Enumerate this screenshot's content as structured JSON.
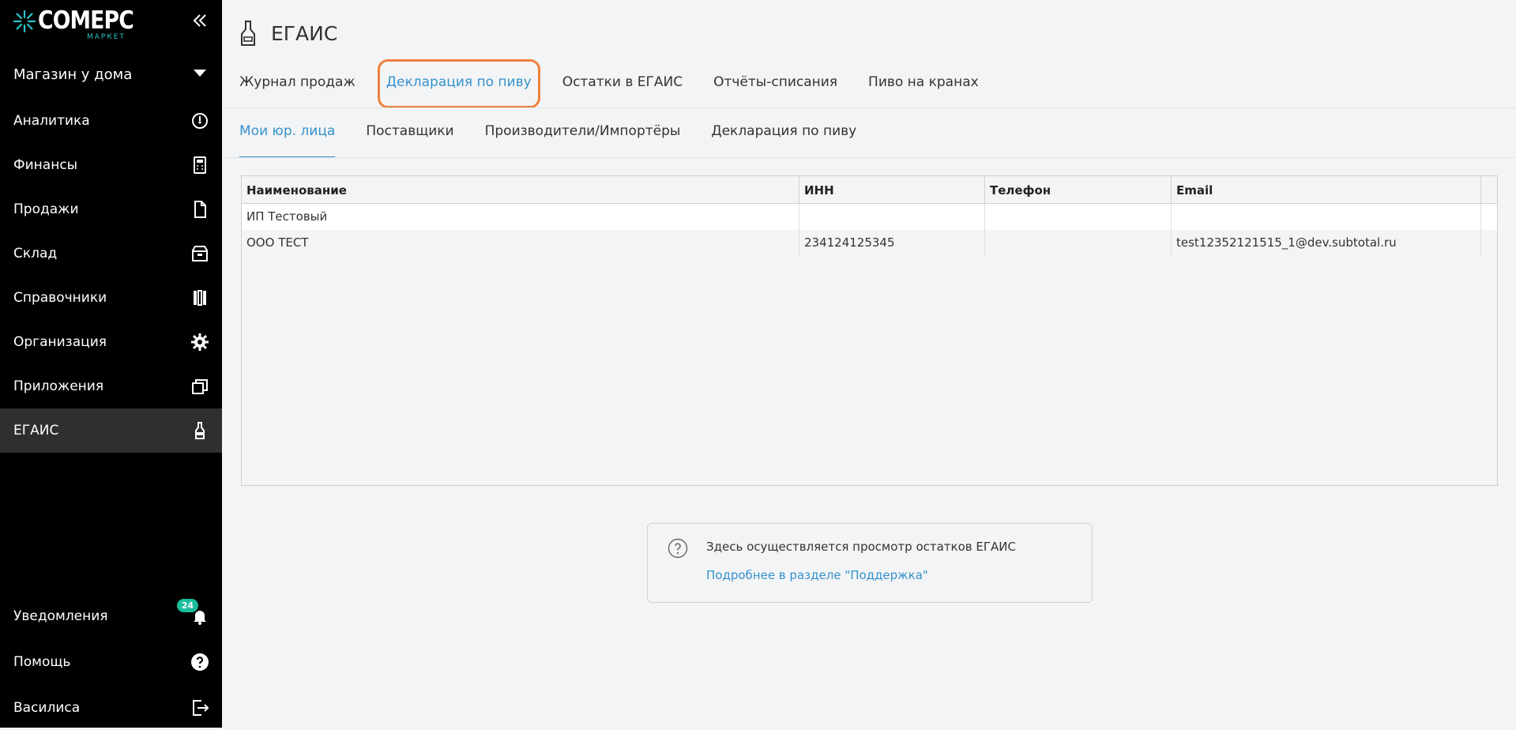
{
  "brand": {
    "name": "COMEPC",
    "sub": "МАРКЕТ",
    "accent": "#2ac3c9"
  },
  "store": {
    "name": "Магазин у дома"
  },
  "nav": [
    {
      "label": "Аналитика",
      "icon": "gauge-icon"
    },
    {
      "label": "Финансы",
      "icon": "calculator-icon"
    },
    {
      "label": "Продажи",
      "icon": "document-icon"
    },
    {
      "label": "Склад",
      "icon": "box-icon"
    },
    {
      "label": "Справочники",
      "icon": "books-icon"
    },
    {
      "label": "Организация",
      "icon": "gear-icon"
    },
    {
      "label": "Приложения",
      "icon": "windows-icon"
    },
    {
      "label": "ЕГАИС",
      "icon": "bottle-icon",
      "active": true
    }
  ],
  "bottom_nav": [
    {
      "label": "Уведомления",
      "icon": "bell-icon",
      "badge": "24"
    },
    {
      "label": "Помощь",
      "icon": "question-icon"
    },
    {
      "label": "Василиса",
      "icon": "logout-icon"
    }
  ],
  "page": {
    "title": "ЕГАИС"
  },
  "tabs": [
    {
      "label": "Журнал продаж"
    },
    {
      "label": "Декларация по пиву",
      "active": true
    },
    {
      "label": "Остатки в ЕГАИС"
    },
    {
      "label": "Отчёты-списания"
    },
    {
      "label": "Пиво на кранах"
    }
  ],
  "subtabs": [
    {
      "label": "Мои юр. лица",
      "active": true
    },
    {
      "label": "Поставщики"
    },
    {
      "label": "Производители/Импортёры"
    },
    {
      "label": "Декларация по пиву"
    }
  ],
  "table": {
    "columns": [
      "Наименование",
      "ИНН",
      "Телефон",
      "Email"
    ],
    "rows": [
      [
        "ИП Тестовый",
        "",
        "",
        ""
      ],
      [
        "ООО ТЕСТ",
        "234124125345",
        "",
        "test12352121515_1@dev.subtotal.ru"
      ]
    ]
  },
  "info": {
    "text": "Здесь осуществляется просмотр остатков ЕГАИС",
    "link": "Подробнее в разделе \"Поддержка\""
  },
  "colors": {
    "link": "#3592cd",
    "highlight": "#f0803c",
    "badge": "#1abc9c"
  }
}
